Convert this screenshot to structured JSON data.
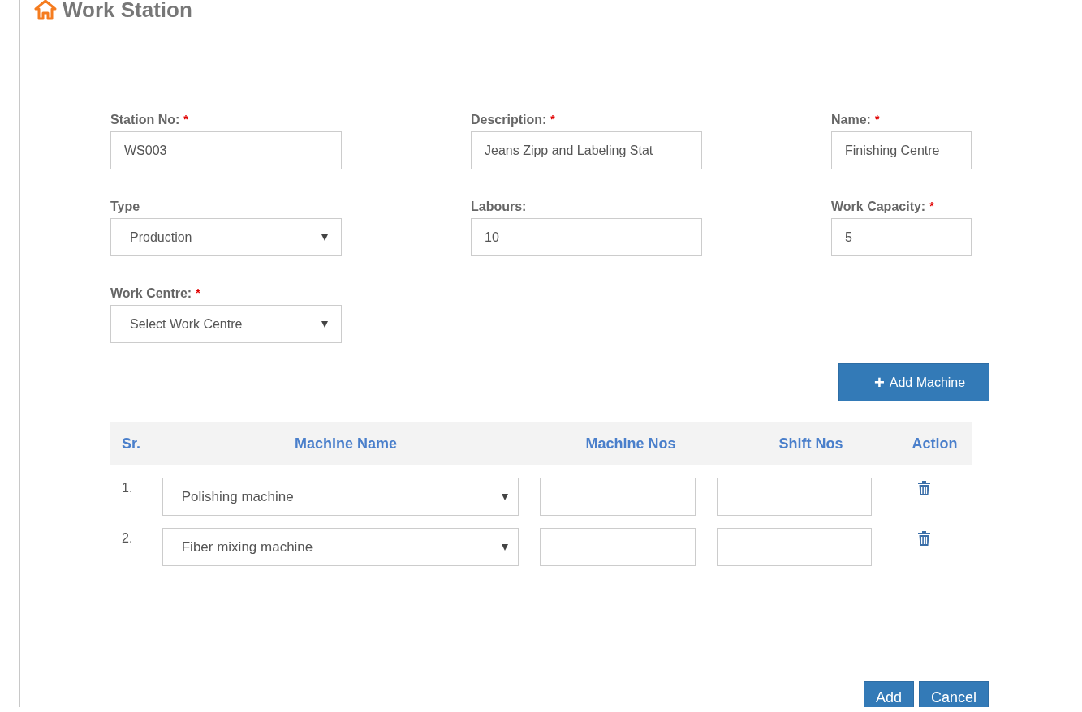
{
  "page": {
    "title": "Work Station"
  },
  "fields": [
    {
      "label": "Station No:",
      "asterisk": "*",
      "kind": "input",
      "value": "WS003"
    },
    {
      "label": "Description:",
      "asterisk": "*",
      "kind": "input",
      "value": "Jeans Zipp and Labeling Stat"
    },
    {
      "label": "Name:",
      "asterisk": "*",
      "kind": "input",
      "value": "Finishing Centre"
    },
    {
      "label": "Type",
      "kind": "select",
      "value": "Production"
    },
    {
      "label": "Labours:",
      "kind": "input",
      "value": "10"
    },
    {
      "label": "Work Capacity:",
      "asterisk": "*",
      "kind": "input",
      "value": "5"
    },
    {
      "label": "Work Centre:",
      "asterisk": "*",
      "kind": "select",
      "value": "Select Work Centre"
    }
  ],
  "add_machine_button": {
    "icon": "+",
    "label": "Add Machine"
  },
  "table": {
    "columns": [
      "Sr.",
      "Machine Name",
      "Machine Nos",
      "Shift Nos",
      "Action"
    ],
    "rows": [
      {
        "sr": "1.",
        "machine": "Polishing machine"
      },
      {
        "sr": "2.",
        "machine": "Fiber mixing machine"
      }
    ]
  },
  "buttons": [
    "Add",
    "Cancel"
  ]
}
